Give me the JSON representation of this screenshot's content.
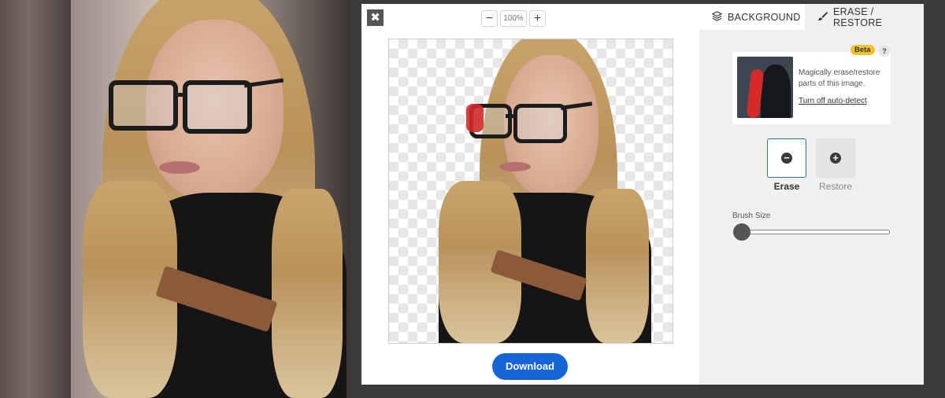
{
  "dialog": {
    "zoom": {
      "minus": "−",
      "value": "100%",
      "plus": "+"
    },
    "close_glyph": "✖",
    "download_label": "Download"
  },
  "panel": {
    "tabs": [
      {
        "label": "BACKGROUND",
        "icon": "layers-icon",
        "active": false
      },
      {
        "label": "ERASE / RESTORE",
        "icon": "brush-icon",
        "active": true
      }
    ],
    "beta_badge": "Beta",
    "help": "?",
    "info_text": "Magically erase/restore parts of this image.",
    "info_link": "Turn off auto-detect",
    "modes": [
      {
        "label": "Erase",
        "icon": "minus-circle-icon",
        "selected": true
      },
      {
        "label": "Restore",
        "icon": "plus-circle-icon",
        "selected": false
      }
    ],
    "brush_size_label": "Brush Size",
    "brush_size_value": 0
  },
  "colors": {
    "accent": "#1565d8",
    "beta": "#f2c12e",
    "erase_highlight": "#d32a2a"
  }
}
